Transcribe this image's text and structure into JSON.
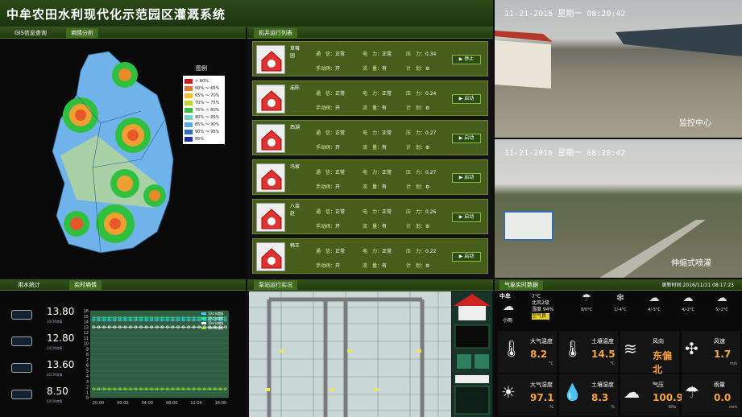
{
  "header": {
    "title": "中牟农田水利现代化示范园区灌溉系统"
  },
  "gis": {
    "tabs": [
      "GIS信息查询",
      "墒情分析"
    ],
    "legend_title": "图例",
    "legend": [
      {
        "label": "< 60%",
        "color": "#c81e1e"
      },
      {
        "label": "60% ～ 65%",
        "color": "#e8742a"
      },
      {
        "label": "65% ～ 70%",
        "color": "#f0c229"
      },
      {
        "label": "70% ～ 75%",
        "color": "#c8d32a"
      },
      {
        "label": "75% ～ 80%",
        "color": "#3dbe3d"
      },
      {
        "label": "80% ～ 85%",
        "color": "#6fd8c8"
      },
      {
        "label": "85% ～ 90%",
        "color": "#5aa9e6"
      },
      {
        "label": "90% ～ 95%",
        "color": "#2f6ad1"
      },
      {
        "label": "95%",
        "color": "#1b2fa8"
      }
    ]
  },
  "pump": {
    "title": "机井运行列表",
    "labels": {
      "comm": "通　信：",
      "power": "电　力：",
      "pressure": "压　力：",
      "valve": "手动阀：",
      "flow": "流　量：",
      "plan": "计　划："
    },
    "rows": [
      {
        "name": "草莓园",
        "comm": "正常",
        "power": "正常",
        "pressure": "0.34",
        "valve": "开",
        "flow": "有",
        "btn": "停止"
      },
      {
        "name": "庙陈",
        "comm": "正常",
        "power": "正常",
        "pressure": "0.24",
        "valve": "开",
        "flow": "有",
        "btn": "启动"
      },
      {
        "name": "西湖",
        "comm": "正常",
        "power": "正常",
        "pressure": "0.27",
        "valve": "开",
        "flow": "有",
        "btn": "启动"
      },
      {
        "name": "冯家",
        "comm": "正常",
        "power": "正常",
        "pressure": "0.27",
        "valve": "开",
        "flow": "有",
        "btn": "启动"
      },
      {
        "name": "八亩赵",
        "comm": "正常",
        "power": "正常",
        "pressure": "0.26",
        "valve": "开",
        "flow": "有",
        "btn": "启动"
      },
      {
        "name": "韩王",
        "comm": "正常",
        "power": "正常",
        "pressure": "0.22",
        "valve": "开",
        "flow": "有",
        "btn": "启动"
      }
    ]
  },
  "cams": [
    {
      "ts": "11-21-2016 星期一 08:20:42",
      "label": "监控中心"
    },
    {
      "ts": "11-21-2016 星期一 08:20:42",
      "label": "伸缩式喷灌"
    }
  ],
  "water": {
    "tabs": [
      "用水统计",
      "实时墒情"
    ],
    "meters": [
      {
        "value": "13.80",
        "sub": "30CM墒情"
      },
      {
        "value": "12.80",
        "sub": "20CM墒情"
      },
      {
        "value": "13.60",
        "sub": "40CM墒情"
      },
      {
        "value": "8.50",
        "sub": "60CM墒情"
      }
    ],
    "chart_data": {
      "type": "line",
      "x": [
        "20:00",
        "00:00",
        "04:00",
        "08:00",
        "12:00",
        "16:00"
      ],
      "ylim": [
        0,
        16
      ],
      "yticks": [
        0,
        1,
        2,
        3,
        4,
        5,
        6,
        7,
        8,
        9,
        10,
        11,
        12,
        13,
        14,
        15,
        16
      ],
      "series": [
        {
          "name": "10cm墒情",
          "color": "#3ad0ff",
          "values": [
            14.3,
            14.3,
            14.3,
            14.3,
            14.3,
            14.3,
            14.3,
            14.3,
            14.3,
            14.3,
            14.3,
            14.3,
            14.3,
            14.3,
            14.3,
            14.3,
            14.3,
            14.3,
            14.3,
            14.3,
            14.3,
            14.3,
            14.3,
            14.3,
            14.3,
            14.3
          ]
        },
        {
          "name": "20cm墒情",
          "color": "#29e6a0",
          "values": [
            14.7,
            14.7,
            14.7,
            14.7,
            14.7,
            14.7,
            14.7,
            14.7,
            14.7,
            14.7,
            14.7,
            14.7,
            14.7,
            14.7,
            14.7,
            14.7,
            14.7,
            14.7,
            14.7,
            14.7,
            14.7,
            14.7,
            14.7,
            14.7,
            14.7,
            14.7
          ]
        },
        {
          "name": "30cm墒情",
          "color": "#ffffff",
          "values": [
            13.0,
            13.0,
            13.0,
            13.0,
            13.0,
            13.0,
            13.0,
            13.0,
            13.0,
            13.0,
            13.0,
            13.0,
            13.0,
            13.0,
            13.0,
            13.0,
            13.0,
            13.0,
            13.0,
            13.0,
            13.0,
            13.0,
            13.0,
            13.0,
            13.0,
            13.0
          ]
        },
        {
          "name": "40cm墒情",
          "color": "#9adf3a",
          "values": [
            1.6,
            1.6,
            1.6,
            1.6,
            1.6,
            1.6,
            1.6,
            1.6,
            1.6,
            1.6,
            1.6,
            1.6,
            1.6,
            1.6,
            1.6,
            1.6,
            1.6,
            1.6,
            1.6,
            1.6,
            1.6,
            1.6,
            1.6,
            1.6,
            1.6,
            1.6
          ]
        }
      ]
    }
  },
  "station": {
    "title": "泵站运行实况"
  },
  "weather": {
    "title": "气象实时数据",
    "updated": "更新时间:2016/11/21 08:17:23",
    "forecast": [
      {
        "day": "中牟",
        "temp": "7°C",
        "cond": "小雨",
        "wind": "北风2级",
        "hum": "湿度 94%",
        "aqi": "空气良",
        "icon": "☁"
      },
      {
        "temp": "8/0°C",
        "icon": "☂"
      },
      {
        "temp": "1/-4°C",
        "icon": "❄"
      },
      {
        "temp": "4/-5°C",
        "icon": "☁"
      },
      {
        "temp": "4/-2°C",
        "icon": "☁"
      },
      {
        "temp": "5/-2°C",
        "icon": "☁"
      }
    ],
    "cells": [
      {
        "label": "大气温度",
        "value": "8.2",
        "unit": "°C",
        "icon": "🌡"
      },
      {
        "label": "土壤温度",
        "value": "14.5",
        "unit": "°C",
        "icon": "🌡"
      },
      {
        "label": "风向",
        "value": "东偏北",
        "unit": "",
        "icon": "≋"
      },
      {
        "label": "风速",
        "value": "1.7",
        "unit": "m/s",
        "icon": "✣"
      },
      {
        "label": "大气湿度",
        "value": "97.1",
        "unit": "%",
        "icon": "☀"
      },
      {
        "label": "土壤湿度",
        "value": "8.3",
        "unit": "%",
        "icon": "💧"
      },
      {
        "label": "气压",
        "value": "100.9",
        "unit": "KPa",
        "icon": "☁"
      },
      {
        "label": "雨量",
        "value": "0.0",
        "unit": "mm",
        "icon": "☂"
      }
    ]
  }
}
